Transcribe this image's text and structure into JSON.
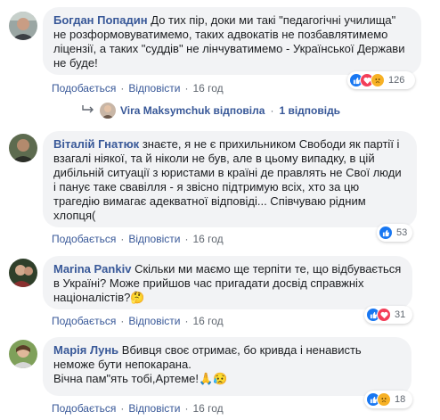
{
  "common": {
    "like_label": "Подобається",
    "reply_label": "Відповісти",
    "dot": "·"
  },
  "comments": [
    {
      "author": "Богдан Попадин",
      "text": "До тих пір, доки ми такі \"педагогічні училища\" не розформовуватимемо, таких адвокатів не позбавлятимемо ліцензії, а таких \"суддів\" не лінчуватимемо - Української Держави не буде!",
      "time": "16 год",
      "reactions": [
        "like",
        "love",
        "sad"
      ],
      "reaction_count": "126"
    },
    {
      "author": "Віталій Гнатюк",
      "text": "знаєте, я не є прихильником Свободи як партії і взагалі ніякої, та й ніколи не був, але в цьому випадку, в цій дибільній ситуації з юристами в країні де правлять не Свої люди і панує таке свавілля - я звісно підтримую всіх, хто за цю трагедію вимагає адекватної відповіді... Співчуваю рідним хлопця(",
      "time": "16 год",
      "reactions": [
        "like"
      ],
      "reaction_count": "53"
    },
    {
      "author": "Marina Pankiv",
      "text": "Скільки ми маємо ще терпіти те, що відбувається в Україні? Може прийшов час пригадати досвід справжніх націоналістів?🤔",
      "time": "16 год",
      "reactions": [
        "like",
        "love"
      ],
      "reaction_count": "31"
    },
    {
      "author": "Марія Лунь",
      "text": "Вбивця своє отримає, бо кривда і ненависть неможе бути непокарана.",
      "text2": "Вічна пам\"ять тобі,Артеме!🙏😥",
      "time": "16 год",
      "reactions": [
        "like",
        "sad"
      ],
      "reaction_count": "18"
    }
  ],
  "reply_summary": {
    "icon": "reply-arrow-icon",
    "name": "Vira Maksymchuk",
    "replied": "відповіла",
    "count_label": "1 відповідь"
  }
}
